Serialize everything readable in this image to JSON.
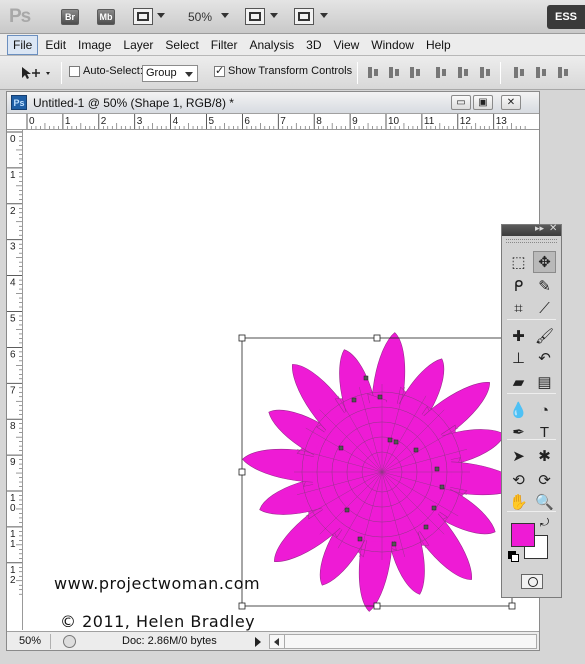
{
  "app": {
    "logo": "Ps",
    "bridge_label": "Br",
    "minibridge_label": "Mb",
    "zoom": "50%",
    "workspace_label": "ESS"
  },
  "menu": {
    "items": [
      "File",
      "Edit",
      "Image",
      "Layer",
      "Select",
      "Filter",
      "Analysis",
      "3D",
      "View",
      "Window",
      "Help"
    ]
  },
  "options": {
    "auto_select_label": "Auto-Select:",
    "auto_select_checked": false,
    "auto_select_mode": "Group",
    "show_transform_label": "Show Transform Controls",
    "show_transform_checked": true
  },
  "document": {
    "title": "Untitled-1 @ 50% (Shape 1, RGB/8) *",
    "ps_badge": "Ps",
    "minimize_label": "▭",
    "maximize_label": "▣",
    "close_label": "✕",
    "ruler_top_labels": [
      "0",
      "1",
      "2",
      "3",
      "4",
      "5",
      "6",
      "7",
      "8",
      "9",
      "10",
      "11",
      "12",
      "13"
    ],
    "ruler_left_labels": [
      "0",
      "1",
      "2",
      "3",
      "4",
      "5",
      "6",
      "7",
      "8",
      "9",
      "10",
      "11",
      "12"
    ],
    "zoom_status": "50%",
    "doc_size": "Doc: 2.86M/0 bytes",
    "shape_color": "#ee1bd5"
  },
  "watermark": {
    "line1": "© 2011, Helen Bradley",
    "line2": "www.projectwoman.com"
  },
  "tools": {
    "foreground_color": "#ee1bd5",
    "background_color": "#ffffff",
    "items": [
      {
        "name": "marquee-tool-icon",
        "glyph": "⬚"
      },
      {
        "name": "move-tool-icon",
        "glyph": "✥"
      },
      {
        "name": "lasso-tool-icon",
        "glyph": "ᑭ"
      },
      {
        "name": "quick-selection-tool-icon",
        "glyph": "✎"
      },
      {
        "name": "crop-tool-icon",
        "glyph": "⌗"
      },
      {
        "name": "eyedropper-tool-icon",
        "glyph": "⟋"
      },
      {
        "name": "healing-brush-tool-icon",
        "glyph": "✚"
      },
      {
        "name": "brush-tool-icon",
        "glyph": "🖌"
      },
      {
        "name": "clone-stamp-tool-icon",
        "glyph": "⊥"
      },
      {
        "name": "history-brush-tool-icon",
        "glyph": "↶"
      },
      {
        "name": "eraser-tool-icon",
        "glyph": "▰"
      },
      {
        "name": "gradient-tool-icon",
        "glyph": "▤"
      },
      {
        "name": "blur-tool-icon",
        "glyph": "💧"
      },
      {
        "name": "dodge-tool-icon",
        "glyph": "◔"
      },
      {
        "name": "pen-tool-icon",
        "glyph": "✒"
      },
      {
        "name": "type-tool-icon",
        "glyph": "T"
      },
      {
        "name": "path-selection-tool-icon",
        "glyph": "➤"
      },
      {
        "name": "shape-tool-icon",
        "glyph": "✱"
      },
      {
        "name": "3d-rotate-tool-icon",
        "glyph": "⟲"
      },
      {
        "name": "3d-orbit-tool-icon",
        "glyph": "⟳"
      },
      {
        "name": "hand-tool-icon",
        "glyph": "✋"
      },
      {
        "name": "zoom-tool-icon",
        "glyph": "🔍"
      }
    ]
  }
}
